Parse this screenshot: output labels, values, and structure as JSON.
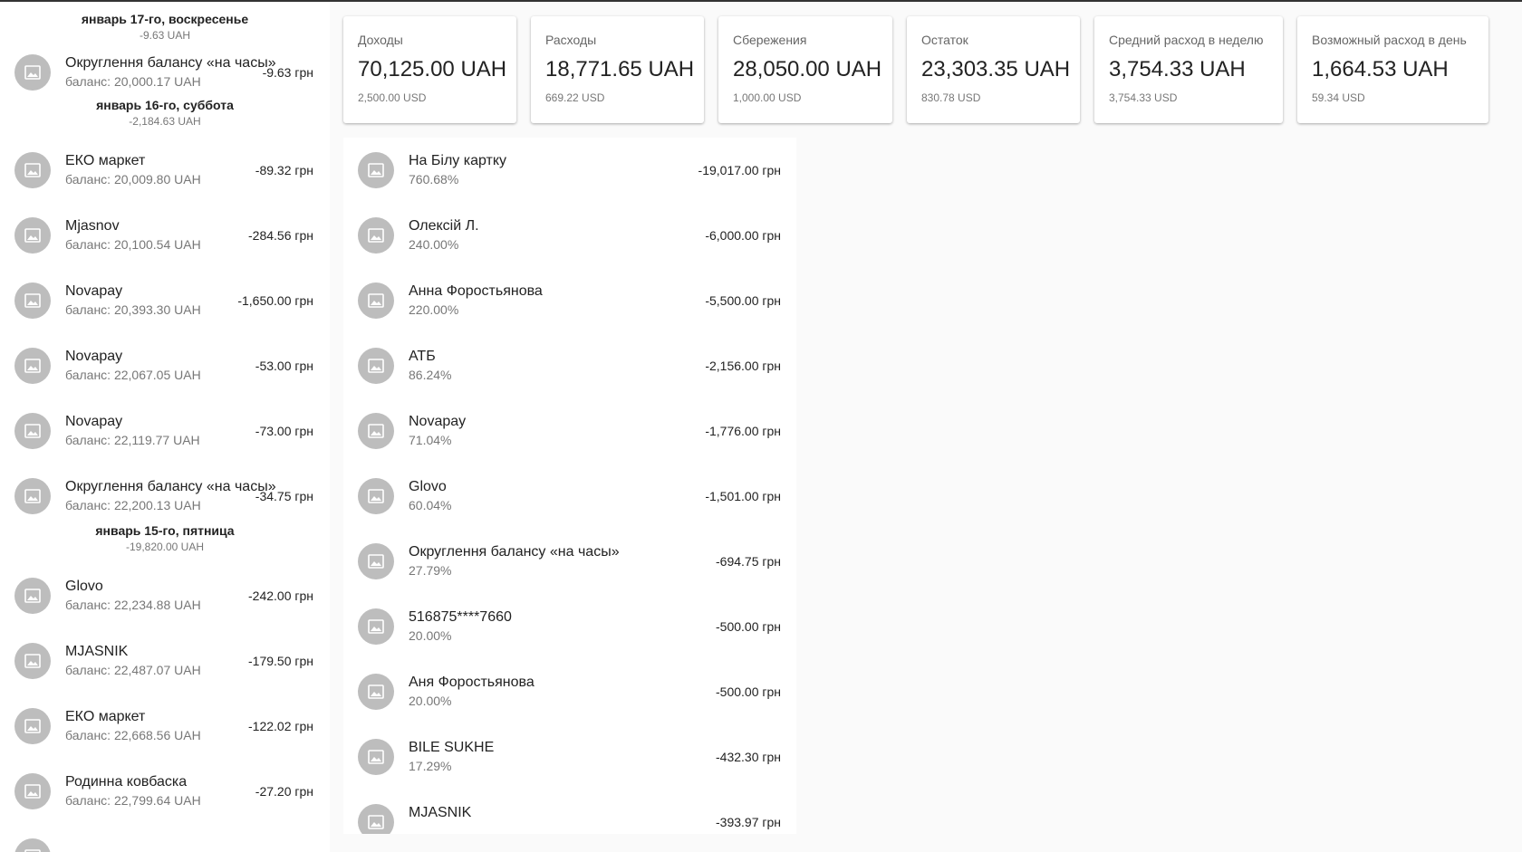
{
  "left_panel": {
    "days": [
      {
        "title": "январь 17-го, воскресенье",
        "sum": "-9.63 UAH",
        "transactions": [
          {
            "name": "Округлення балансу «на часы»",
            "balance": "баланс: 20,000.17 UAH",
            "amount": "-9.63 грн"
          }
        ]
      },
      {
        "title": "январь 16-го, суббота",
        "sum": "-2,184.63 UAH",
        "transactions": [
          {
            "name": "ЕКО маркет",
            "balance": "баланс: 20,009.80 UAH",
            "amount": "-89.32 грн"
          },
          {
            "name": "Mjasnov",
            "balance": "баланс: 20,100.54 UAH",
            "amount": "-284.56 грн"
          },
          {
            "name": "Novapay",
            "balance": "баланс: 20,393.30 UAH",
            "amount": "-1,650.00 грн"
          },
          {
            "name": "Novapay",
            "balance": "баланс: 22,067.05 UAH",
            "amount": "-53.00 грн"
          },
          {
            "name": "Novapay",
            "balance": "баланс: 22,119.77 UAH",
            "amount": "-73.00 грн"
          },
          {
            "name": "Округлення балансу «на часы»",
            "balance": "баланс: 22,200.13 UAH",
            "amount": "-34.75 грн"
          }
        ]
      },
      {
        "title": "январь 15-го, пятница",
        "sum": "-19,820.00 UAH",
        "transactions": [
          {
            "name": "Glovo",
            "balance": "баланс: 22,234.88 UAH",
            "amount": "-242.00 грн"
          },
          {
            "name": "MJASNIK",
            "balance": "баланс: 22,487.07 UAH",
            "amount": "-179.50 грн"
          },
          {
            "name": "ЕКО маркет",
            "balance": "баланс: 22,668.56 UAH",
            "amount": "-122.02 грн"
          },
          {
            "name": "Родинна ковбаска",
            "balance": "баланс: 22,799.64 UAH",
            "amount": "-27.20 грн"
          },
          {
            "name": "",
            "balance": "",
            "amount": ""
          }
        ]
      }
    ]
  },
  "stats": [
    {
      "label": "Доходы",
      "value": "70,125.00 UAH",
      "sub": "2,500.00 USD"
    },
    {
      "label": "Расходы",
      "value": "18,771.65 UAH",
      "sub": "669.22 USD"
    },
    {
      "label": "Сбережения",
      "value": "28,050.00 UAH",
      "sub": "1,000.00 USD"
    },
    {
      "label": "Остаток",
      "value": "23,303.35 UAH",
      "sub": "830.78 USD"
    },
    {
      "label": "Средний расход в неделю",
      "value": "3,754.33 UAH",
      "sub": "3,754.33 USD"
    },
    {
      "label": "Возможный расход в день",
      "value": "1,664.53 UAH",
      "sub": "59.34 USD"
    }
  ],
  "expenses": [
    {
      "name": "На Білу картку",
      "percent": "760.68%",
      "amount": "-19,017.00 грн"
    },
    {
      "name": "Олексій Л.",
      "percent": "240.00%",
      "amount": "-6,000.00 грн"
    },
    {
      "name": "Анна Форостьянова",
      "percent": "220.00%",
      "amount": "-5,500.00 грн"
    },
    {
      "name": "АТБ",
      "percent": "86.24%",
      "amount": "-2,156.00 грн"
    },
    {
      "name": "Novapay",
      "percent": "71.04%",
      "amount": "-1,776.00 грн"
    },
    {
      "name": "Glovo",
      "percent": "60.04%",
      "amount": "-1,501.00 грн"
    },
    {
      "name": "Округлення балансу «на часы»",
      "percent": "27.79%",
      "amount": "-694.75 грн"
    },
    {
      "name": "516875****7660",
      "percent": "20.00%",
      "amount": "-500.00 грн"
    },
    {
      "name": "Аня Форостьянова",
      "percent": "20.00%",
      "amount": "-500.00 грн"
    },
    {
      "name": "BILE SUKHE",
      "percent": "17.29%",
      "amount": "-432.30 грн"
    },
    {
      "name": "MJASNIK",
      "percent": "",
      "amount": "-393.97 грн"
    }
  ]
}
